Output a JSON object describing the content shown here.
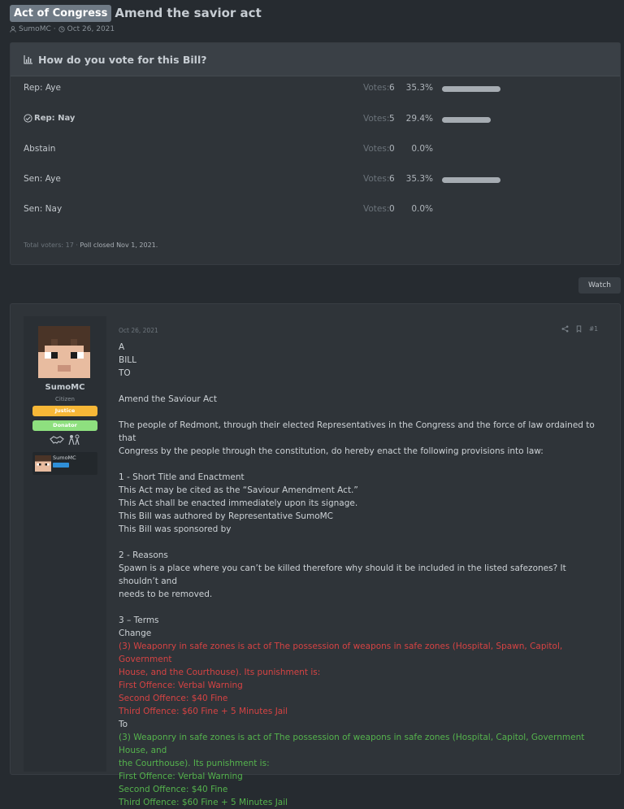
{
  "thread": {
    "prefix": "Act of Congress",
    "title": "Amend the savior act",
    "author": "SumoMC",
    "separator": "·",
    "date": "Oct 26, 2021"
  },
  "poll": {
    "question": "How do you vote for this Bill?",
    "votes_label": "Votes:",
    "options": [
      {
        "label": "Rep: Aye",
        "votes": "6",
        "percent": "35.3%",
        "fraction": 0.353,
        "voted": false
      },
      {
        "label": "Rep: Nay",
        "votes": "5",
        "percent": "29.4%",
        "fraction": 0.294,
        "voted": true
      },
      {
        "label": "Abstain",
        "votes": "0",
        "percent": "0.0%",
        "fraction": 0,
        "voted": false
      },
      {
        "label": "Sen: Aye",
        "votes": "6",
        "percent": "35.3%",
        "fraction": 0.353,
        "voted": false
      },
      {
        "label": "Sen: Nay",
        "votes": "0",
        "percent": "0.0%",
        "fraction": 0,
        "voted": false
      }
    ],
    "total_voters_label": "Total voters: 17 ·",
    "closed_text": "Poll closed Nov 1, 2021."
  },
  "watch_label": "Watch",
  "post": {
    "username": "SumoMC",
    "user_title": "Citizen",
    "badges": [
      "Justice",
      "Donator"
    ],
    "mini_name": "SumoMC",
    "date": "Oct 26, 2021",
    "number": "#1",
    "lines": [
      {
        "t": "A",
        "c": ""
      },
      {
        "t": "BILL",
        "c": ""
      },
      {
        "t": "TO",
        "c": ""
      },
      {
        "t": "",
        "c": ""
      },
      {
        "t": "Amend the Saviour Act",
        "c": ""
      },
      {
        "t": "",
        "c": ""
      },
      {
        "t": "The people of Redmont, through their elected Representatives in the Congress and the force of law ordained to that",
        "c": ""
      },
      {
        "t": "Congress by the people through the constitution, do hereby enact the following provisions into law:",
        "c": ""
      },
      {
        "t": "",
        "c": ""
      },
      {
        "t": "1 - Short Title and Enactment",
        "c": ""
      },
      {
        "t": "This Act may be cited as the “Saviour Amendment Act.”",
        "c": ""
      },
      {
        "t": "This Act shall be enacted immediately upon its signage.",
        "c": ""
      },
      {
        "t": "This Bill was authored by Representative SumoMC",
        "c": ""
      },
      {
        "t": "This Bill was sponsored by",
        "c": ""
      },
      {
        "t": "",
        "c": ""
      },
      {
        "t": "2 - Reasons",
        "c": ""
      },
      {
        "t": "Spawn is a place where you can’t be killed therefore why should it be included in the listed safezones? It shouldn’t and",
        "c": ""
      },
      {
        "t": "needs to be removed.",
        "c": ""
      },
      {
        "t": "",
        "c": ""
      },
      {
        "t": "3 – Terms",
        "c": ""
      },
      {
        "t": "Change",
        "c": ""
      },
      {
        "t": "(3) Weaponry in safe zones is act of The possession of weapons in safe zones (Hospital, Spawn, Capitol, Government",
        "c": "red"
      },
      {
        "t": "House, and the Courthouse). Its punishment is:",
        "c": "red"
      },
      {
        "t": "First Offence: Verbal Warning",
        "c": "red"
      },
      {
        "t": "Second Offence: $40 Fine",
        "c": "red"
      },
      {
        "t": "Third Offence: $60 Fine + 5 Minutes Jail",
        "c": "red"
      },
      {
        "t": "To",
        "c": ""
      },
      {
        "t": "(3) Weaponry in safe zones is act of The possession of weapons in safe zones (Hospital, Capitol, Government House, and",
        "c": "green"
      },
      {
        "t": "the Courthouse). Its punishment is:",
        "c": "green"
      },
      {
        "t": "First Offence: Verbal Warning",
        "c": "green"
      },
      {
        "t": "Second Offence: $40 Fine",
        "c": "green"
      },
      {
        "t": "Third Offence: $60 Fine + 5 Minutes Jail",
        "c": "green"
      }
    ]
  },
  "colors": {
    "accent_red": "#d64343",
    "accent_green": "#55b34d",
    "badge_justice": "#f7b737",
    "badge_donator": "#8ee07f"
  }
}
